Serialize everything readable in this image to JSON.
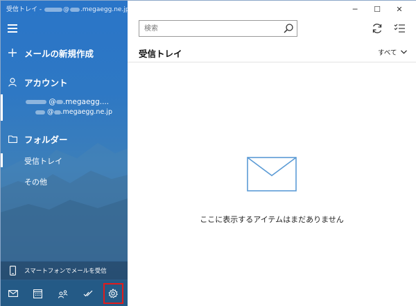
{
  "titlebar": {
    "prefix": "受信トレイ - ",
    "domain": "@",
    "suffix": ".megaegg.ne.jp"
  },
  "sidebar": {
    "new_mail": "メールの新規作成",
    "accounts_label": "アカウント",
    "account": {
      "line1_at": "@",
      "line1_domain": ".megaegg....",
      "line2_at": "@",
      "line2_domain": ".megaegg.ne.jp"
    },
    "folders_label": "フォルダー",
    "folders": [
      {
        "label": "受信トレイ",
        "selected": true
      },
      {
        "label": "その他",
        "selected": false
      }
    ],
    "phone_promo": "スマートフォンでメールを受信",
    "bottom_buttons": [
      "mail-icon",
      "calendar-icon",
      "people-icon",
      "todo-icon",
      "gear-icon"
    ]
  },
  "toolbar": {
    "search_placeholder": "検索",
    "window_minimize": "─",
    "window_maximize": "☐",
    "window_close": "✕"
  },
  "list": {
    "title": "受信トレイ",
    "filter_label": "すべて",
    "empty_message": "ここに表示するアイテムはまだありません"
  },
  "colors": {
    "sidebar_blue": "#2a75c8",
    "bottom_bar": "#245a86",
    "settings_highlight": "#e21b1b",
    "empty_icon": "#5b9bd5"
  }
}
